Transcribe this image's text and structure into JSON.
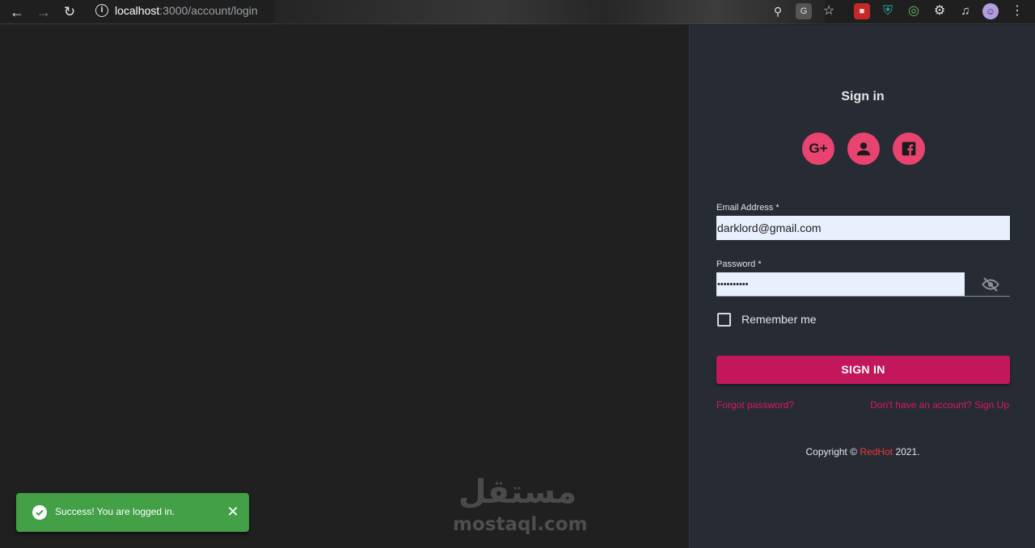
{
  "browser": {
    "url_host": "localhost",
    "url_path": ":3000/account/login",
    "icons": [
      "back-arrow-icon",
      "forward-arrow-icon",
      "reload-icon",
      "info-icon",
      "key-icon",
      "translate-icon",
      "star-icon",
      "extension-icons",
      "puzzle-icon",
      "playlist-icon",
      "profile-avatar",
      "more-menu-icon"
    ]
  },
  "login": {
    "title": "Sign in",
    "social": [
      {
        "name": "google-plus",
        "label": "G+"
      },
      {
        "name": "guest-account",
        "label": ""
      },
      {
        "name": "facebook",
        "label": ""
      }
    ],
    "email_label": "Email Address *",
    "email_value": "darklord@gmail.com",
    "password_label": "Password *",
    "password_value": "••••••••••",
    "remember_label": "Remember me",
    "remember_checked": false,
    "submit_label": "SIGN IN",
    "forgot_link": "Forgot password?",
    "signup_link": "Don't have an account? Sign Up",
    "copyright_prefix": "Copyright ©",
    "copyright_brand": "RedHot",
    "copyright_year": "2021."
  },
  "toast": {
    "message": "Success! You are logged in.",
    "type": "success"
  },
  "watermark": {
    "arabic": "مستقل",
    "latin": "mostaql.com"
  },
  "colors": {
    "accent": "#e94370",
    "button": "#c2185b",
    "link": "#d81b60",
    "brand": "#e53935",
    "success": "#43a047",
    "panel_bg": "#272b34"
  }
}
